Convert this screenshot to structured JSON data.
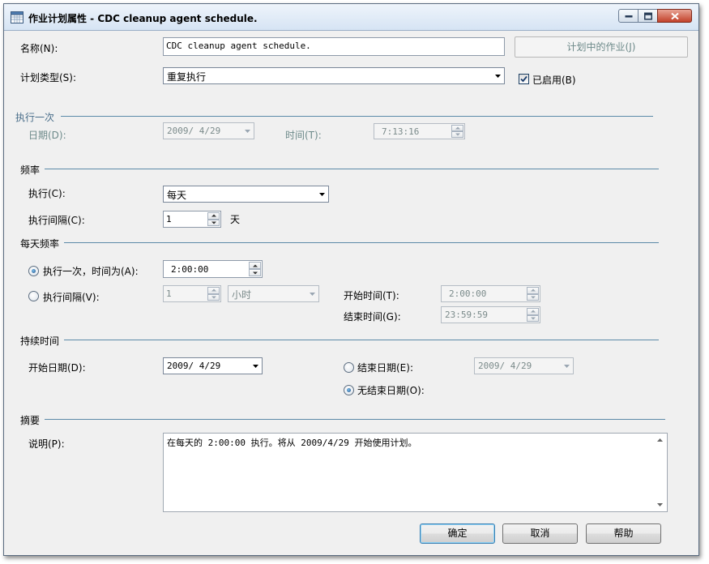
{
  "window": {
    "title": "作业计划属性 - CDC cleanup agent schedule."
  },
  "name": {
    "label": "名称(N):",
    "value": "CDC cleanup agent schedule."
  },
  "jobs_in_schedule_button": "计划中的作业(J)",
  "schedule_type": {
    "label": "计划类型(S):",
    "value": "重复执行"
  },
  "enabled": {
    "label": "已启用(B)",
    "checked": true
  },
  "one_time": {
    "section": "执行一次",
    "date_label": "日期(D):",
    "date_value": "2009/ 4/29",
    "time_label": "时间(T):",
    "time_value": "7:13:16"
  },
  "frequency": {
    "section": "频率",
    "occurs_label": "执行(C):",
    "occurs_value": "每天",
    "recurs_label": "执行间隔(C):",
    "recurs_value": "1",
    "recurs_unit": "天"
  },
  "daily_frequency": {
    "section": "每天频率",
    "once_label": "执行一次，时间为(A):",
    "once_value": "2:00:00",
    "once_selected": true,
    "every_label": "执行间隔(V):",
    "every_value": "1",
    "every_unit": "小时",
    "start_label": "开始时间(T):",
    "start_value": "2:00:00",
    "end_label": "结束时间(G):",
    "end_value": "23:59:59"
  },
  "duration": {
    "section": "持续时间",
    "start_label": "开始日期(D):",
    "start_value": "2009/ 4/29",
    "end_date_label": "结束日期(E):",
    "end_date_value": "2009/ 4/29",
    "no_end_label": "无结束日期(O):",
    "no_end_selected": true
  },
  "summary": {
    "section": "摘要",
    "desc_label": "说明(P):",
    "desc_value": "在每天的 2:00:00 执行。将从 2009/4/29 开始使用计划。"
  },
  "buttons": {
    "ok": "确定",
    "cancel": "取消",
    "help": "帮助"
  },
  "colors": {
    "section_line": "#5c8aa8",
    "disabled_text": "#6d8a8a",
    "title_bar": "#d6e4f4"
  }
}
